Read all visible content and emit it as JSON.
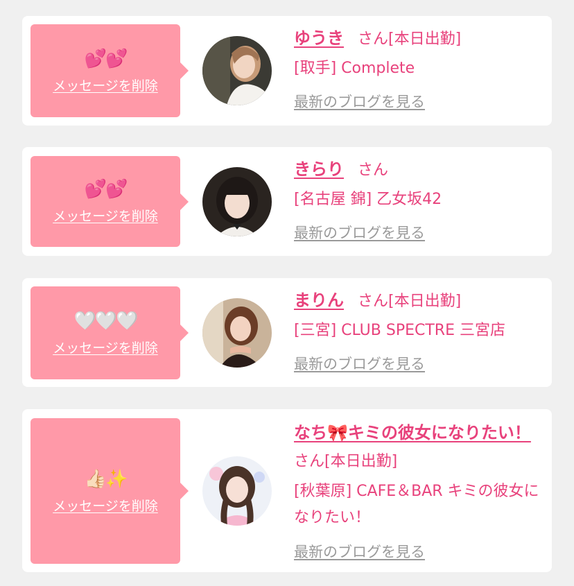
{
  "cards": [
    {
      "emoji": "💕💕",
      "delete_label": "メッセージを削除",
      "name": "ゆうき",
      "honorific": "さん",
      "status": "[本日出勤]",
      "shop": "[取手] Complete",
      "blog_label": "最新のブログを見る"
    },
    {
      "emoji": "💕💕",
      "delete_label": "メッセージを削除",
      "name": "きらり",
      "honorific": "さん",
      "status": "",
      "shop": "[名古屋 錦] 乙女坂42",
      "blog_label": "最新のブログを見る"
    },
    {
      "emoji": "🤍🤍🤍",
      "delete_label": "メッセージを削除",
      "name": "まりん",
      "honorific": "さん",
      "status": "[本日出勤]",
      "shop": "[三宮] CLUB SPECTRE 三宮店",
      "blog_label": "最新のブログを見る"
    },
    {
      "emoji": "👍🏻✨",
      "delete_label": "メッセージを削除",
      "name": "なち🎀キミの彼女になりたい！",
      "honorific": "さん",
      "status": "[本日出勤]",
      "shop": "[秋葉原] CAFE＆BAR キミの彼女になりたい！",
      "blog_label": "最新のブログを見る"
    }
  ],
  "colors": {
    "accent": "#e8427c",
    "bubble": "#ff99a8",
    "muted": "#9a9a9a",
    "background": "#f0f0f0"
  }
}
